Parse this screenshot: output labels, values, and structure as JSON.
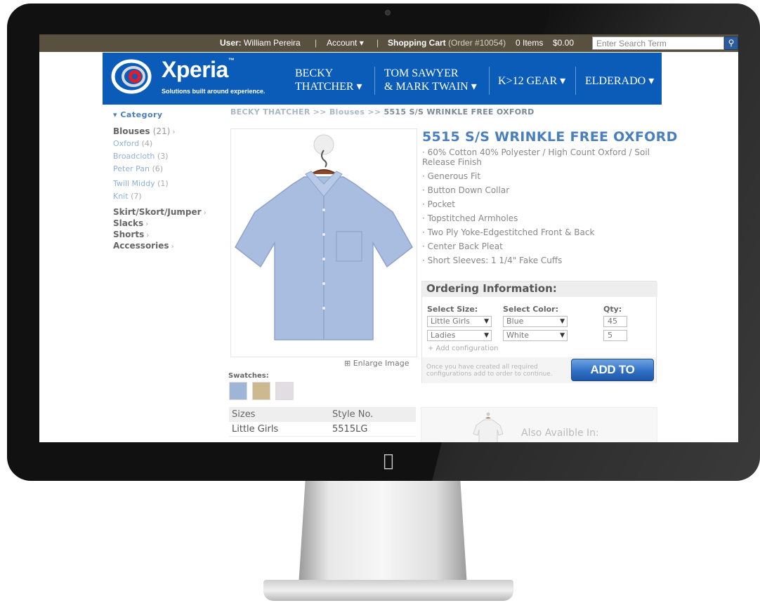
{
  "topbar": {
    "user_label": "User:",
    "user_name": "William Pereira",
    "sep1": "|",
    "account": "Account",
    "sep2": "|",
    "cart_label": "Shopping Cart",
    "order": "(Order #10054)",
    "items": "0 Items",
    "total": "$0.00",
    "search_placeholder": "Enter Search Term"
  },
  "brand": {
    "name": "Xperia",
    "tm": "™",
    "tagline": "Solutions built around experience."
  },
  "nav": [
    {
      "line1": "BECKY",
      "line2": "THATCHER ▾"
    },
    {
      "line1": "TOM SAWYER",
      "line2": "& MARK TWAIN ▾"
    },
    {
      "label": "K>12 GEAR ▾"
    },
    {
      "label": "ELDERADO ▾"
    }
  ],
  "sidebar": {
    "heading": "▾  Category",
    "main": {
      "label": "Blouses",
      "count": "(21)"
    },
    "sub": [
      {
        "label": "Oxford",
        "count": "(4)"
      },
      {
        "label": "Broadcloth",
        "count": "(3)"
      },
      {
        "label": "Peter Pan",
        "count": "(6)"
      },
      {
        "label": "Twill Middy",
        "count": "(1)"
      },
      {
        "label": "Knit",
        "count": "(7)"
      }
    ],
    "others": [
      "Skirt/Skort/Jumper",
      "Slacks",
      "Shorts",
      "Accessories"
    ]
  },
  "breadcrumb": {
    "part1": "BECKY THATCHER",
    "sep": ">>",
    "part2": "Blouses",
    "current": "5515 S/S WRINKLE FREE OXFORD"
  },
  "product": {
    "title": "5515 S/S WRINKLE FREE OXFORD",
    "features": [
      "· 60% Cotton 40% Polyester / High Count Oxford / Soil Release Finish",
      "· Generous Fit",
      "· Button Down Collar",
      "· Pocket",
      "· Topstitched Armholes",
      "· Two Ply Yoke-Edgestitched Front & Back",
      "· Center Back Pleat",
      "· Short Sleeves: 1 1/4\" Fake Cuffs"
    ],
    "enlarge": "⊞ Enlarge Image",
    "swatches_label": "Swatches:",
    "swatch_colors": [
      "#9fb5d6",
      "#cdb98f",
      "#e2dde2"
    ]
  },
  "ordering": {
    "heading": "Ordering Information:",
    "size_label": "Select Size:",
    "color_label": "Select Color:",
    "qty_label": "Qty:",
    "rows": [
      {
        "size": "Little Girls",
        "color": "Blue",
        "qty": "45"
      },
      {
        "size": "Ladies",
        "color": "White",
        "qty": "5"
      }
    ],
    "add_config": "+ Add configuration",
    "note": "Once you have created all required configurations add to order to continue.",
    "button": "ADD TO ORDER"
  },
  "sizes_table": {
    "headers": [
      "Sizes",
      "Style No."
    ],
    "rows": [
      [
        "Little Girls",
        "5515LG"
      ]
    ]
  },
  "also": {
    "text": "Also Availble In:"
  }
}
